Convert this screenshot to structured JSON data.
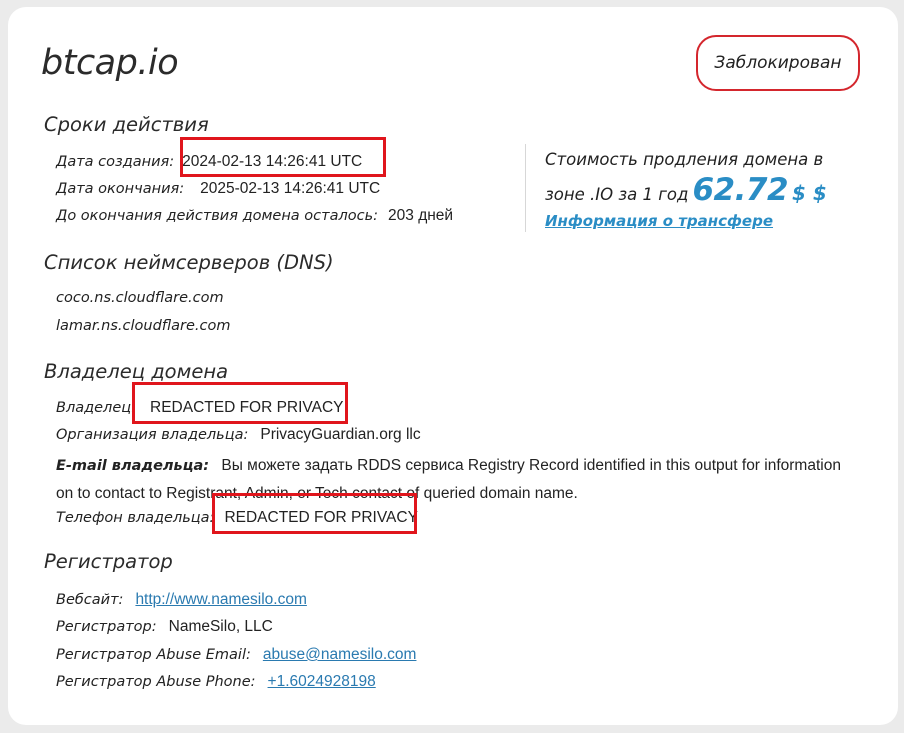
{
  "domain": "btcap.io",
  "status": "Заблокирован",
  "validity": {
    "title": "Сроки действия",
    "created_label": "Дата создания:",
    "created_value": "2024-02-13 14:26:41 UTC",
    "expires_label": "Дата окончания:",
    "expires_value": "2025-02-13 14:26:41 UTC",
    "remaining_label": "До окончания действия домена осталось:",
    "remaining_value": "203 дней"
  },
  "renewal": {
    "text_line1": "Стоимость продления домена в",
    "text_line2": "зоне .IO за 1 год",
    "price": "62.72",
    "currency": "$ $",
    "transfer_link": "Информация о трансфере"
  },
  "dns": {
    "title": "Список неймсерверов (DNS)",
    "servers": [
      "coco.ns.cloudflare.com",
      "lamar.ns.cloudflare.com"
    ]
  },
  "owner": {
    "title": "Владелец домена",
    "owner_label": "Владелец:",
    "owner_value": "REDACTED FOR PRIVACY",
    "org_label": "Организация владельца:",
    "org_value": "PrivacyGuardian.org llc",
    "email_label": "E-mail владельца:",
    "email_value": "Вы можете задать RDDS сервиса Registry Record identified in this output for information on to contact to Registrant, Admin, or Tech contact of queried domain name.",
    "phone_label": "Телефон владельца:",
    "phone_value": "REDACTED FOR PRIVACY"
  },
  "registrar": {
    "title": "Регистратор",
    "website_label": "Вебсайт:",
    "website_value": "http://www.namesilo.com",
    "name_label": "Регистратор:",
    "name_value": "NameSilo, LLC",
    "abuse_email_label": "Регистратор Abuse Email:",
    "abuse_email_value": "abuse@namesilo.com",
    "abuse_phone_label": "Регистратор Abuse Phone:",
    "abuse_phone_value": "+1.6024928198"
  },
  "colors": {
    "accent": "#2a8dc5",
    "highlight": "#e0151c",
    "status_border": "#d4262d"
  }
}
